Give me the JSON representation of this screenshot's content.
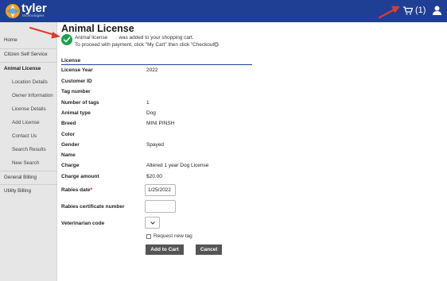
{
  "brand": {
    "name": "tyler",
    "tagline": "technologies"
  },
  "header": {
    "cart_label": "(1)"
  },
  "sidebar": {
    "items": [
      {
        "label": "Home"
      },
      {
        "label": "Citizen Self Service"
      },
      {
        "label": "Animal License"
      },
      {
        "label": "Location Details"
      },
      {
        "label": "Owner Information"
      },
      {
        "label": "License Details"
      },
      {
        "label": "Add License"
      },
      {
        "label": "Contact Us"
      },
      {
        "label": "Search Results"
      },
      {
        "label": "New Search"
      },
      {
        "label": "General Billing"
      },
      {
        "label": "Utility Billing"
      }
    ]
  },
  "main": {
    "title": "Animal License",
    "message": {
      "item": "Animal license",
      "text": "was added to your shopping cart.",
      "instruction": "To proceed with payment, click \"My Cart\" then click \"Checkout\"."
    },
    "section_title": "License",
    "rows": [
      {
        "label": "License Year",
        "value": "2022"
      },
      {
        "label": "Customer ID",
        "value": ""
      },
      {
        "label": "Tag number",
        "value": ""
      },
      {
        "label": "Number of tags",
        "value": "1"
      },
      {
        "label": "Animal type",
        "value": "Dog"
      },
      {
        "label": "Breed",
        "value": "MINI PINSH"
      },
      {
        "label": "Color",
        "value": ""
      },
      {
        "label": "Gender",
        "value": "Spayed"
      },
      {
        "label": "Name",
        "value": ""
      },
      {
        "label": "Charge",
        "value": "Altered 1 year Dog License"
      },
      {
        "label": "Charge amount",
        "value": "$20.00"
      }
    ],
    "rabies_date": {
      "label": "Rabies date",
      "required": "*",
      "value": "1/25/2022"
    },
    "rabies_cert": {
      "label": "Rabies certificate number",
      "value": ""
    },
    "vet_code": {
      "label": "Veterinarian code",
      "value": ""
    },
    "request_new_tag": {
      "label": "Request new tag",
      "checked": false
    },
    "buttons": {
      "add": "Add to Cart",
      "cancel": "Cancel"
    }
  },
  "colors": {
    "header": "#1f3f94",
    "sidebar": "#e6e6e6",
    "button": "#555555",
    "success": "#1aa34a",
    "annotation": "#e03a2f"
  }
}
